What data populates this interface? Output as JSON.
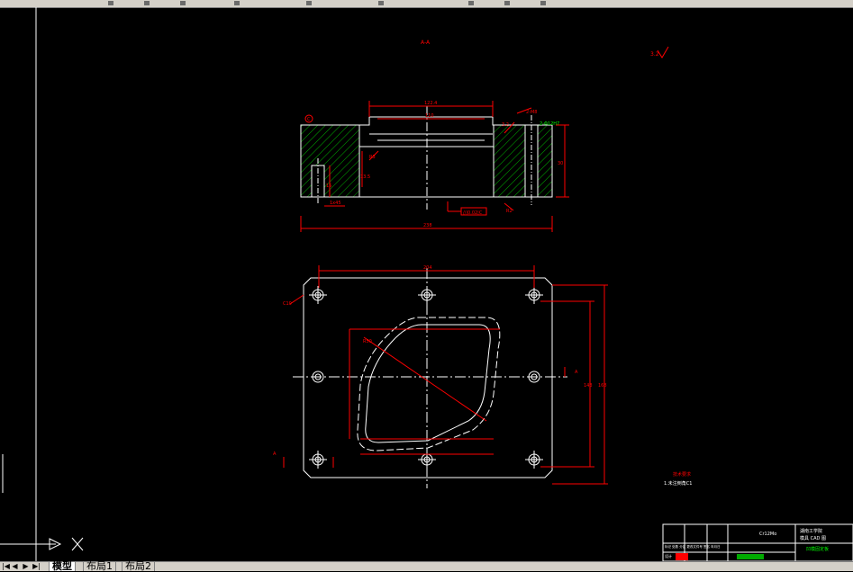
{
  "drawing": {
    "section_label": "A-A",
    "roughness": "3.2",
    "sect_dims": {
      "overall_width": "238",
      "top_width": "122.4",
      "inner_width": "110",
      "height": "30",
      "chamfer": "1x45",
      "hole_depth": "15",
      "hole_dia": "2-M8",
      "tol_frame": "//|0.02|C",
      "fit_callout": "2-Φ12H7",
      "small_dim": "R2",
      "r_callout": "R3",
      "side_dim": "13.5",
      "chamfer2": "3.2",
      "datum": "C"
    },
    "plan_dims": {
      "top": "204",
      "right_outer": "168",
      "right_inner": "143",
      "diag": "R50",
      "corner": "C10",
      "left_a": "A",
      "right_a": "A"
    },
    "notes_title": "技术要求",
    "notes_text": "1.未注倒角C1"
  },
  "title_block": {
    "part_name": "Cr12Mo",
    "school": "湖南工学院",
    "drawing_no": "模具 CAD 图",
    "scale_row": "标记 处数  分区 更改文件号 签名 年月日",
    "design": "设计",
    "label2": "凹模固定板"
  },
  "tabs": [
    "模型",
    "布局1",
    "布局2"
  ],
  "nav": [
    "◀",
    "▶",
    "|◀",
    "▶|"
  ],
  "colors": {
    "background": "#000000",
    "geometry": "#ffffff",
    "dimension": "#ff0000",
    "hatch": "#00aa00",
    "frame": "#ffffff",
    "title_green": "#00ff00"
  }
}
